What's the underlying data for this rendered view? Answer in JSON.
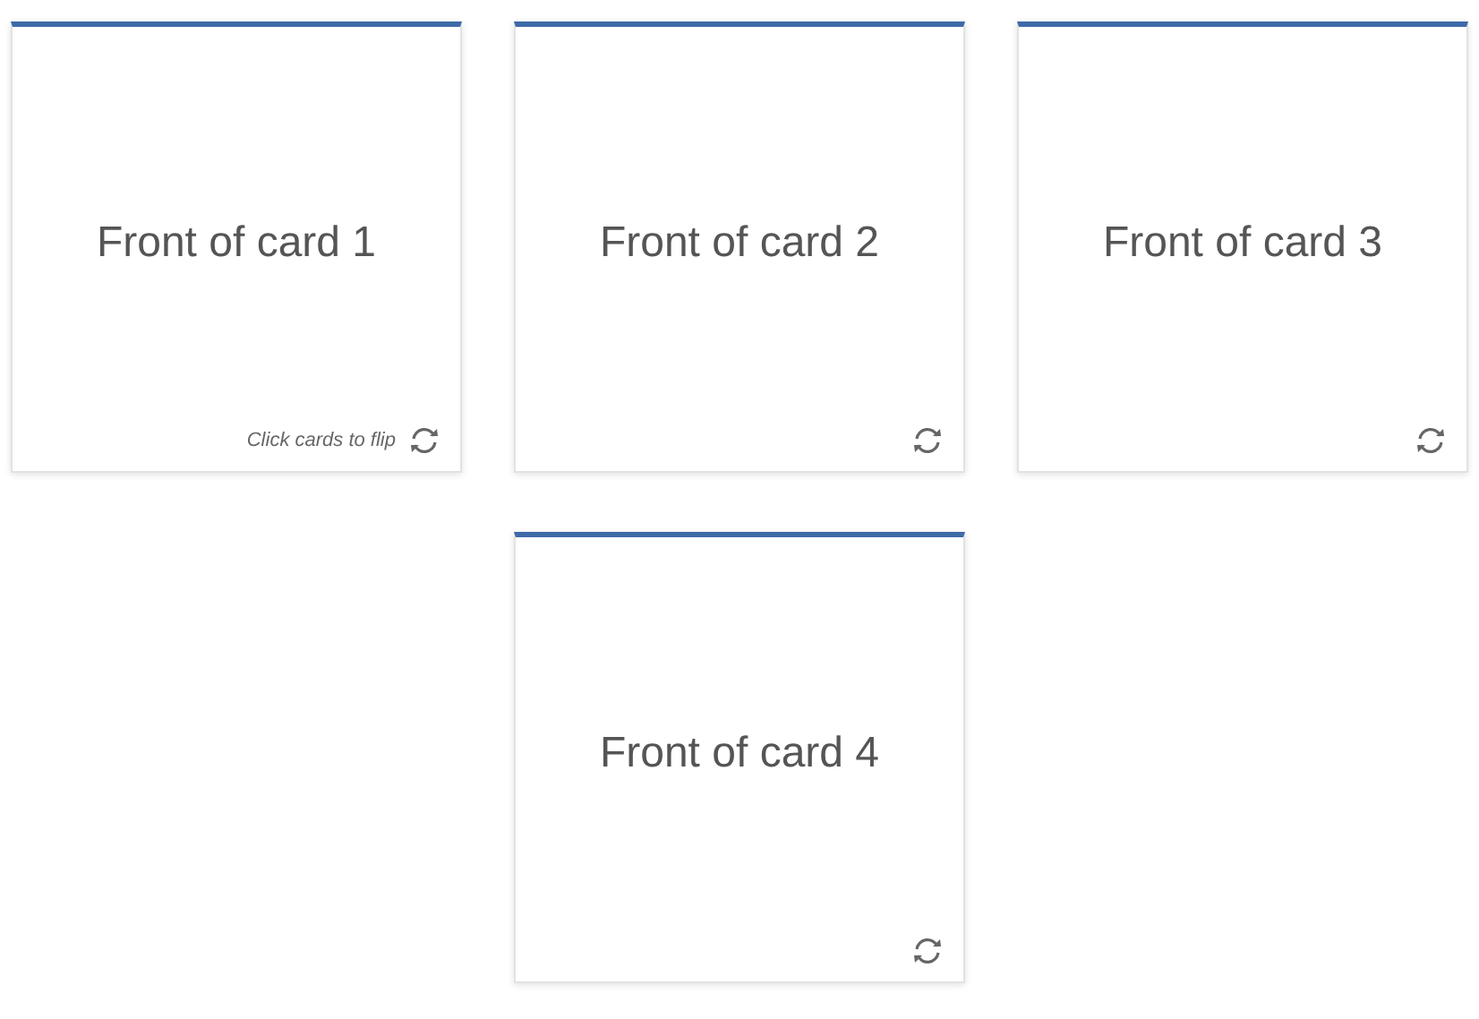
{
  "cards": [
    {
      "front": "Front of card 1",
      "hint": "Click cards to flip"
    },
    {
      "front": "Front of card 2"
    },
    {
      "front": "Front of card 3"
    },
    {
      "front": "Front of card 4"
    }
  ]
}
